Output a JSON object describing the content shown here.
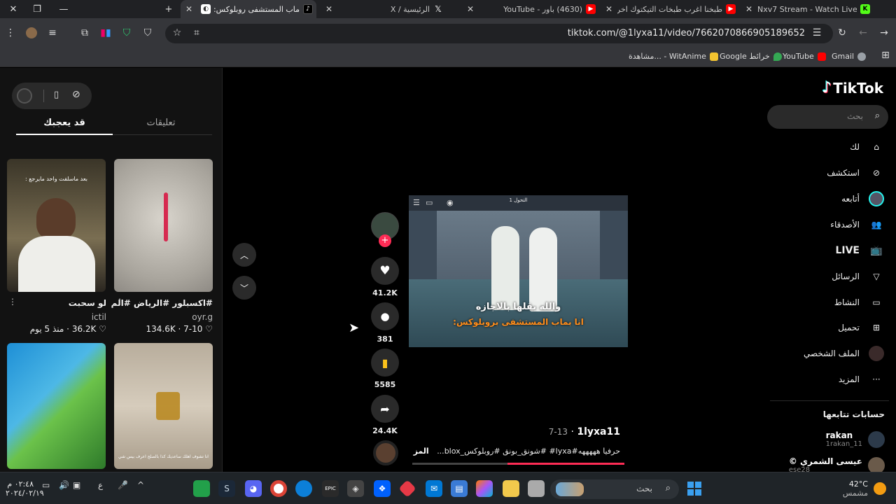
{
  "browser": {
    "tabs": [
      {
        "title": "Nxv7 Stream - Watch Live on Kick",
        "icon": "kick-icon",
        "color": "#53fc18"
      },
      {
        "title": "طبخنا اغرب طبخات التيكتوك اخر",
        "icon": "youtube-icon",
        "color": "#ff0000"
      },
      {
        "title": "(4630) باور - YouTube",
        "icon": "youtube-icon",
        "color": "#ff0000"
      },
      {
        "title": "",
        "icon": "x-icon",
        "color": "#ffffff"
      },
      {
        "title": "الرئيسية / X",
        "icon": "x-icon",
        "color": "#ffffff"
      },
      {
        "title": "ماب المستشفى روبلوكس: وا",
        "icon": "tiktok-icon",
        "color": "#000000"
      }
    ],
    "url": "tiktok.com/@1lyxa11/video/7662070866905189652",
    "bookmarks": [
      {
        "label": "Gmail",
        "color": "#ea4335"
      },
      {
        "label": "YouTube",
        "color": "#ff0000"
      },
      {
        "label": "Google خرائط",
        "color": "#34a853"
      },
      {
        "label": "مشاهدة... - WitAnime",
        "color": "#f4c430"
      }
    ]
  },
  "tiktok": {
    "logo": "TikTok",
    "search_placeholder": "بحث",
    "nav": [
      {
        "label": "لك",
        "icon": "home-icon",
        "bold": false
      },
      {
        "label": "استكشف",
        "icon": "compass-icon",
        "bold": false
      },
      {
        "label": "أتابعه",
        "icon": "following-avatar-icon",
        "bold": false
      },
      {
        "label": "الأصدقاء",
        "icon": "friends-icon",
        "bold": false
      },
      {
        "label": "LIVE",
        "icon": "live-icon",
        "bold": true
      },
      {
        "label": "الرسائل",
        "icon": "send-icon",
        "bold": false
      },
      {
        "label": "النشاط",
        "icon": "activity-icon",
        "bold": false
      },
      {
        "label": "تحميل",
        "icon": "upload-icon",
        "bold": false
      },
      {
        "label": "الملف الشخصي",
        "icon": "profile-icon",
        "bold": false
      },
      {
        "label": "المزيد",
        "icon": "more-icon",
        "bold": false
      }
    ],
    "following_header": "حسابات تتابعها",
    "following": [
      {
        "name": "rakan",
        "handle": "1rakan_11"
      },
      {
        "name": "عيسى الشمري ©",
        "handle": "ese28"
      }
    ],
    "video": {
      "author": "1lyxa11",
      "date": "7-13",
      "caption_line1": "والله بقلها بالاجازه",
      "caption_line2": "انا بماب المستشفى بروبلوكس:",
      "top_label": "التحول 1",
      "description": "حرفيا هههههه#lyxa# #شونق_بونق #روبلوكس_blox...",
      "more_label": "المزيد",
      "progress": 0.55
    },
    "actions": [
      {
        "name": "like",
        "count": "41.2K",
        "icon": "heart-icon"
      },
      {
        "name": "comment",
        "count": "381",
        "icon": "comment-icon"
      },
      {
        "name": "save",
        "count": "5585",
        "icon": "bookmark-icon"
      },
      {
        "name": "share",
        "count": "24.4K",
        "icon": "share-icon"
      }
    ],
    "panel": {
      "tab_active": "قد يعجبك",
      "tab_inactive": "تعليقات",
      "videos": [
        {
          "overlay": "بعد ماسلفت واحد مايرجع :",
          "title": "لو سحبت",
          "user": "ictil",
          "likes": "36.2K",
          "age": "منذ 5 يوم"
        },
        {
          "overlay": "",
          "title": "#اكسبلور #الرياض #الم",
          "user": "oyr.g",
          "likes": "134.6K",
          "age": "7-10"
        },
        {
          "overlay": "",
          "title": "",
          "user": "",
          "likes": "",
          "age": ""
        },
        {
          "overlay": "انا تشوف اهلك ساعديك كذا بالصلح اعرف بيس شي",
          "title": "",
          "user": "",
          "likes": "",
          "age": ""
        }
      ]
    }
  },
  "taskbar": {
    "search_placeholder": "بحث",
    "weather_temp": "42°C",
    "weather_label": "مشمس",
    "time": "٠٢:٤٨ م",
    "date": "٢٠٢٤/٠٢/١٩",
    "lang": "ع"
  }
}
